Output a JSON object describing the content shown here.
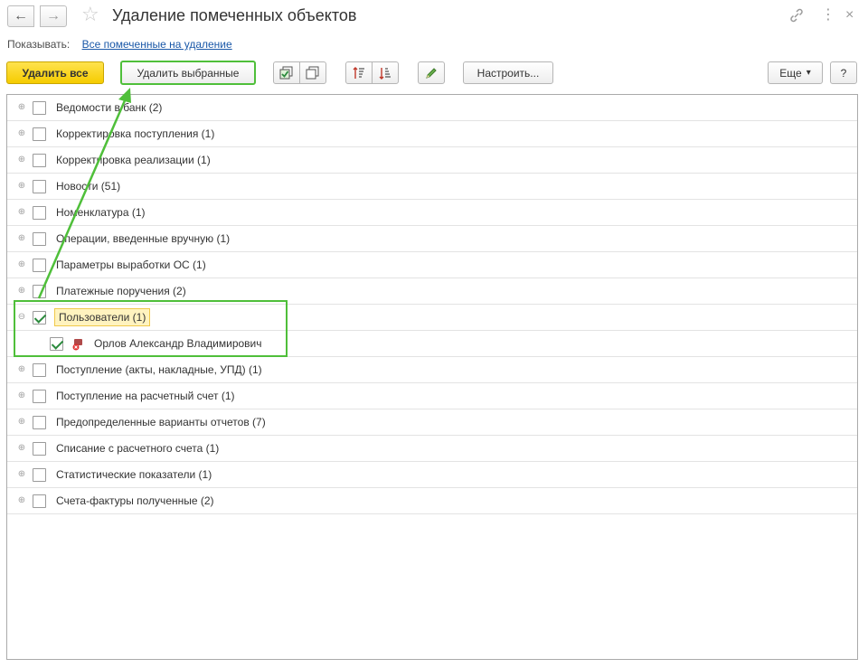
{
  "window": {
    "title": "Удаление помеченных объектов",
    "back_icon": "←",
    "forward_icon": "→",
    "star_icon": "☆",
    "link_icon": "🔗",
    "menu_icon": "⋮",
    "close_icon": "×"
  },
  "filter": {
    "label": "Показывать:",
    "value": "Все помеченные на удаление"
  },
  "toolbar": {
    "delete_all": "Удалить все",
    "delete_selected": "Удалить выбранные",
    "configure": "Настроить...",
    "more": "Еще",
    "more_arrow": "▾",
    "help": "?"
  },
  "list": {
    "items": [
      {
        "label": "Ведомости в банк (2)",
        "checked": false
      },
      {
        "label": "Корректировка поступления (1)",
        "checked": false
      },
      {
        "label": "Корректировка реализации (1)",
        "checked": false
      },
      {
        "label": "Новости (51)",
        "checked": false
      },
      {
        "label": "Номенклатура (1)",
        "checked": false
      },
      {
        "label": "Операции, введенные вручную (1)",
        "checked": false
      },
      {
        "label": "Параметры выработки ОС (1)",
        "checked": false
      },
      {
        "label": "Платежные поручения (2)",
        "checked": false
      },
      {
        "label": "Пользователи (1)",
        "checked": true,
        "expanded": true
      },
      {
        "label": "Орлов Александр Владимирович",
        "checked": true,
        "child": true
      },
      {
        "label": "Поступление (акты, накладные, УПД) (1)",
        "checked": false
      },
      {
        "label": "Поступление на расчетный счет (1)",
        "checked": false
      },
      {
        "label": "Предопределенные варианты отчетов (7)",
        "checked": false
      },
      {
        "label": "Списание с расчетного счета (1)",
        "checked": false
      },
      {
        "label": "Статистические показатели (1)",
        "checked": false
      },
      {
        "label": "Счета-фактуры полученные (2)",
        "checked": false
      }
    ]
  },
  "colors": {
    "accent_yellow": "#f5cc00",
    "annotation_green": "#4fbf3a",
    "link_blue": "#1a58a8"
  }
}
